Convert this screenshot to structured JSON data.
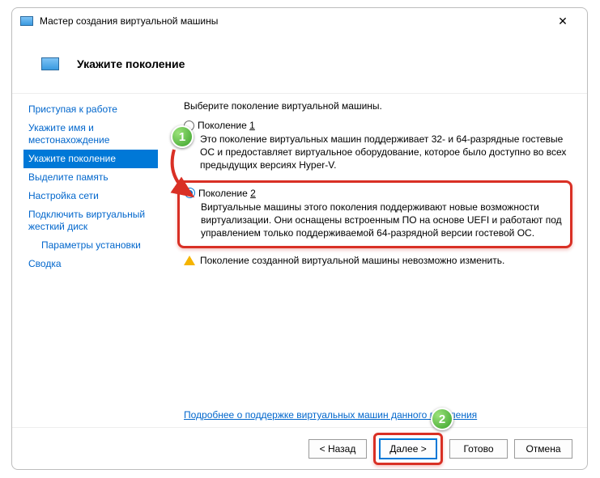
{
  "window": {
    "title": "Мастер создания виртуальной машины"
  },
  "header": {
    "title": "Укажите поколение"
  },
  "sidebar": {
    "items": [
      {
        "label": "Приступая к работе"
      },
      {
        "label": "Укажите имя и местонахождение"
      },
      {
        "label": "Укажите поколение"
      },
      {
        "label": "Выделите память"
      },
      {
        "label": "Настройка сети"
      },
      {
        "label": "Подключить виртуальный жесткий диск"
      },
      {
        "label": "Параметры установки"
      },
      {
        "label": "Сводка"
      }
    ],
    "active_index": 2
  },
  "content": {
    "prompt": "Выберите поколение виртуальной машины.",
    "gen1": {
      "label_prefix": "Поколение ",
      "label_num": "1",
      "desc": "Это поколение виртуальных машин поддерживает 32- и 64-разрядные гостевые ОС и предоставляет виртуальное оборудование, которое было доступно во всех предыдущих версиях Hyper-V."
    },
    "gen2": {
      "label_prefix": "Поколение ",
      "label_num": "2",
      "desc": "Виртуальные машины этого поколения поддерживают новые возможности виртуализации. Они оснащены встроенным ПО на основе UEFI и работают под управлением только поддерживаемой 64-разрядной версии гостевой ОС."
    },
    "warning": "Поколение созданной виртуальной машины невозможно изменить.",
    "link": "Подробнее о поддержке виртуальных машин данного поколения"
  },
  "footer": {
    "back": "< Назад",
    "next": "Далее >",
    "finish": "Готово",
    "cancel": "Отмена"
  },
  "annotations": {
    "marker1": "1",
    "marker2": "2"
  }
}
